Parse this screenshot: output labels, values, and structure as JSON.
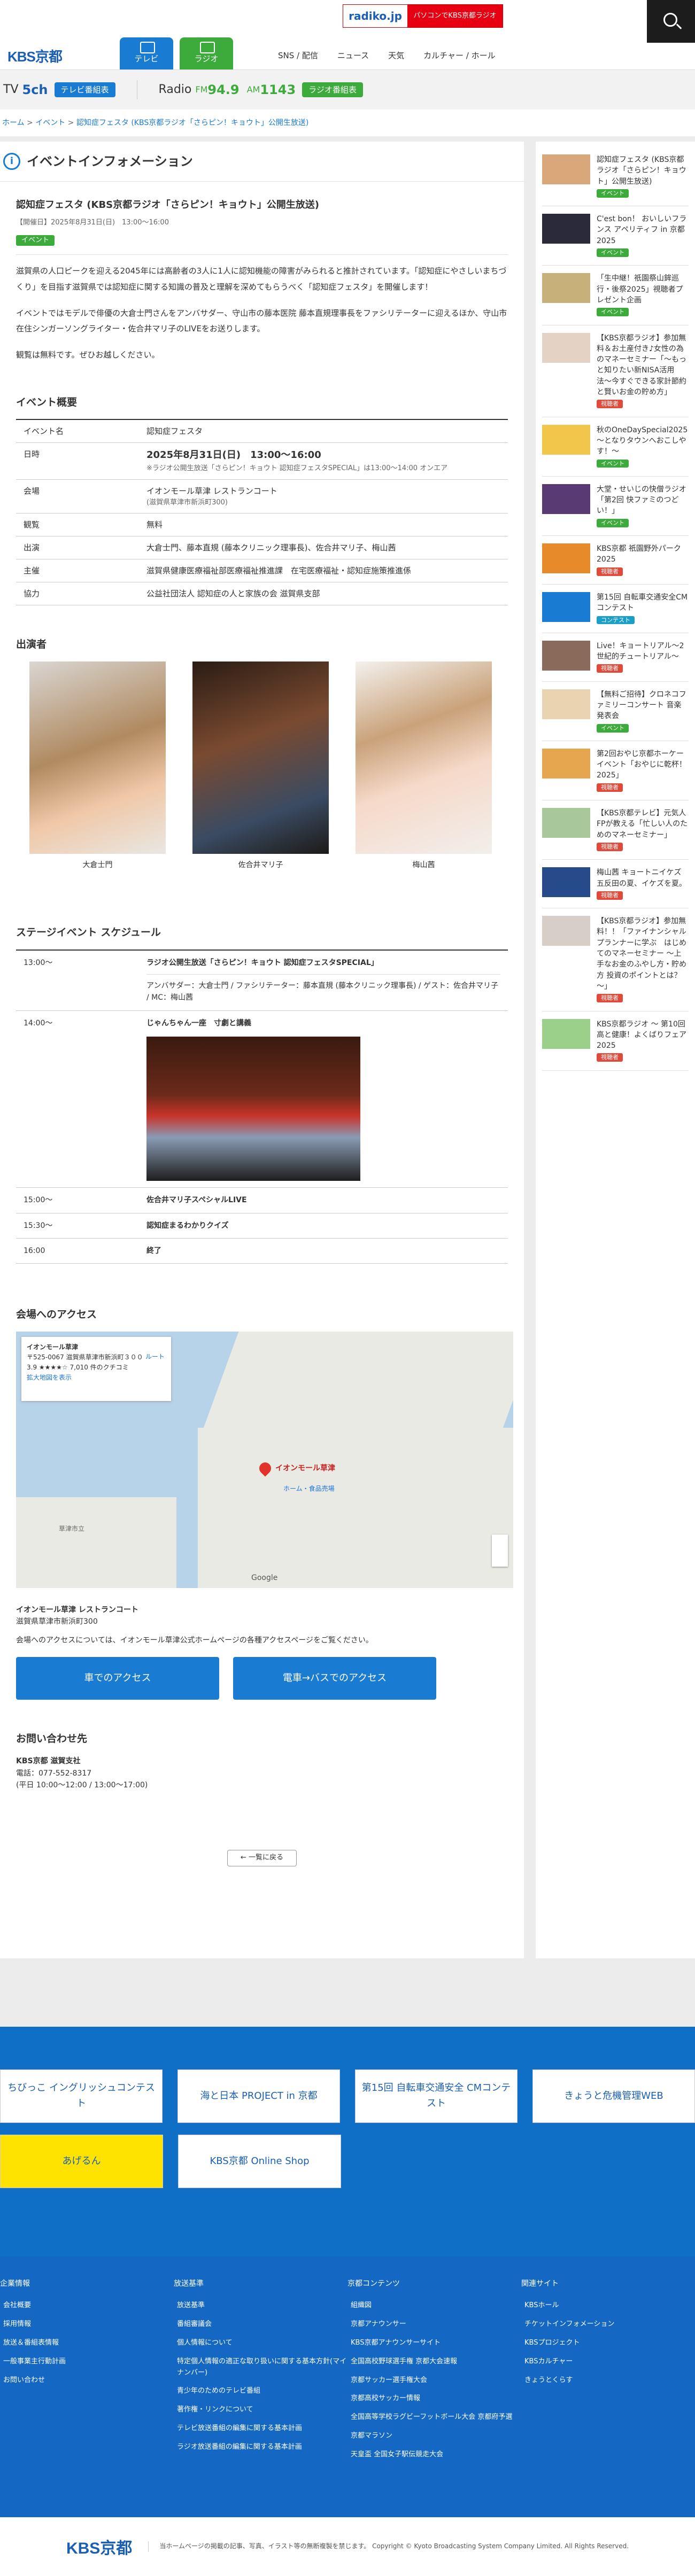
{
  "header": {
    "logo": "KBS京都",
    "tv_tab": "テレビ",
    "radio_tab": "ラジオ",
    "nav": [
      "SNS / 配信",
      "ニュース",
      "天気",
      "カルチャー / ホール"
    ],
    "radiko": {
      "brand": "radiko.jp",
      "text": "パソコンでKBS京都ラジオ"
    }
  },
  "stations": {
    "tv_label": "TV",
    "tv_ch": "5ch",
    "tv_pill": "テレビ番組表",
    "radio_label": "Radio",
    "fm_label": "FM",
    "fm_freq": "94.9",
    "am_label": "AM",
    "am_freq": "1143",
    "radio_pill": "ラジオ番組表"
  },
  "breadcrumb": {
    "home": "ホーム",
    "sep": " > ",
    "events": "イベント",
    "current": "認知症フェスタ (KBS京都ラジオ「さらピン！キョウト」公開生放送)"
  },
  "page_heading": "イベントインフォメーション",
  "article": {
    "title": "認知症フェスタ (KBS京都ラジオ「さらピン！キョウト」公開生放送)",
    "date": "【開催日】2025年8月31日(日)　13:00～16:00",
    "tag": "イベント",
    "paragraphs": [
      "滋賀県の人口ピークを迎える2045年には高齢者の3人に1人に認知機能の障害がみられると推計されています。「認知症にやさしいまちづくり」を目指す滋賀県では認知症に関する知識の普及と理解を深めてもらうべく「認知症フェスタ」を開催します！",
      "イベントではモデルで俳優の大倉士門さんをアンバサダー、守山市の藤本医院 藤本直規理事長をファシリテーターに迎えるほか、守山市在住シンガーソングライター・佐合井マリ子のLIVEをお送りします。",
      "観覧は無料です。ぜひお越しください。"
    ]
  },
  "overview": {
    "heading": "イベント概要",
    "rows": [
      {
        "k": "イベント名",
        "v": "認知症フェスタ",
        "v2": ""
      },
      {
        "k": "日時",
        "v": "2025年8月31日(日)　13:00～16:00",
        "v2": "※ラジオ公開生放送「さらピン！キョウト 認知症フェスタSPECIAL」は13:00～14:00 オンエア"
      },
      {
        "k": "会場",
        "v": "イオンモール草津 レストランコート",
        "v2": "(滋賀県草津市新浜町300)"
      },
      {
        "k": "観覧",
        "v": "無料",
        "v2": ""
      },
      {
        "k": "出演",
        "v": "大倉士門、藤本直規 (藤本クリニック理事長)、佐合井マリ子、梅山茜",
        "v2": ""
      },
      {
        "k": "主催",
        "v": "滋賀県健康医療福祉部医療福祉推進課　在宅医療福祉・認知症施策推進係",
        "v2": ""
      },
      {
        "k": "協力",
        "v": "公益社団法人 認知症の人と家族の会 滋賀県支部",
        "v2": ""
      }
    ]
  },
  "cast": {
    "heading": "出演者",
    "names": [
      "大倉士門",
      "佐合井マリ子",
      "梅山茜"
    ]
  },
  "schedule": {
    "heading": "ステージイベント スケジュール",
    "rows": [
      {
        "t": "13:00～",
        "title": "ラジオ公開生放送「さらピン！キョウト 認知症フェスタSPECIAL」",
        "sub": "アンバサダー：大倉士門 / ファシリテーター：藤本直規 (藤本クリニック理事長) / ゲスト：佐合井マリ子 / MC：梅山茜"
      },
      {
        "t": "14:00～",
        "title": "じゃんちゃん一座　寸劇と講義",
        "sub": ""
      },
      {
        "t": "15:00～",
        "title": "佐合井マリ子スペシャルLIVE",
        "sub": ""
      },
      {
        "t": "15:30～",
        "title": "認知症まるわかりクイズ",
        "sub": ""
      },
      {
        "t": "16:00",
        "title": "終了",
        "sub": ""
      }
    ]
  },
  "access": {
    "heading": "会場へのアクセス",
    "map_card": {
      "name": "イオンモール草津",
      "addr": "〒525-0067 滋賀県草津市新浜町３００",
      "rating": "3.9 ★★★★☆ 7,010 件のクチコミ",
      "link": "拡大地図を表示",
      "route": "ルート"
    },
    "map_labels": [
      "イオンモール草津",
      "ホーム・食品売場",
      "草津市立",
      "Google"
    ],
    "venue": "イオンモール草津 レストランコート",
    "addr": "滋賀県草津市新浜町300",
    "note": "会場へのアクセスについては、イオンモール草津公式ホームページの各種アクセスページをご覧ください。",
    "btn_car": "車でのアクセス",
    "btn_train": "電車→バスでのアクセス"
  },
  "contact": {
    "heading": "お問い合わせ先",
    "org": "KBS京都 滋賀支社",
    "tel": "電話：077-552-8317",
    "hours": "(平日 10:00～12:00 / 13:00～17:00)"
  },
  "back": "一覧に戻る",
  "sidebar": [
    {
      "title": "認知症フェスタ (KBS京都ラジオ「さらピン！キョウト」公開生放送)",
      "tag": "イベント",
      "color": "#3cab3b"
    },
    {
      "title": "C'est bon！ おいしいフランス アペリティフ in 京都2025",
      "tag": "イベント",
      "color": "#3cab3b"
    },
    {
      "title": "「生中継！祇園祭山鉾巡行・後祭2025」視聴者プレゼント企画",
      "tag": "イベント",
      "color": "#3cab3b"
    },
    {
      "title": "【KBS京都ラジオ】参加無料＆お土産付き♪女性の為のマネーセミナー「〜もっと知りたい新NISA活用法〜今すぐできる家計節約と賢いお金の貯め方」",
      "tag": "視聴者",
      "color": "#e04a3a"
    },
    {
      "title": "秋のOneDaySpecial2025 ～となりタウンへおこしやす！～",
      "tag": "イベント",
      "color": "#3cab3b"
    },
    {
      "title": "大堂・せいじの快僧ラジオ「第2回 快ファミのつどい！」",
      "tag": "イベント",
      "color": "#3cab3b"
    },
    {
      "title": "KBS京都 祇園野外パーク2025",
      "tag": "視聴者",
      "color": "#e04a3a"
    },
    {
      "title": "第15回 自転車交通安全CMコンテスト",
      "tag": "コンテスト",
      "color": "#1aa0c8"
    },
    {
      "title": "Live！キョートリアル～2世紀的チュートリアル～",
      "tag": "視聴者",
      "color": "#e04a3a"
    },
    {
      "title": "【無料ご招待】クロネコファミリーコンサート 音楽発表会",
      "tag": "イベント",
      "color": "#3cab3b"
    },
    {
      "title": "第2回おやじ京都ホーケーイベント「おやじに乾杯！2025」",
      "tag": "視聴者",
      "color": "#e04a3a"
    },
    {
      "title": "【KBS京都テレビ】元気人FPが教える「忙しい人のためのマネーセミナー」",
      "tag": "視聴者",
      "color": "#e04a3a"
    },
    {
      "title": "梅山茜 キョートニイケズ　五反田の夏、イケズを夏。",
      "tag": "視聴者",
      "color": "#e04a3a"
    },
    {
      "title": "【KBS京都ラジオ】参加無料！！「ファイナンシャルプランナーに学ぶ　はじめてのマネーセミナー ～上手なお金のふやし方・貯め方 投資のポイントとは？～」",
      "tag": "視聴者",
      "color": "#e04a3a"
    },
    {
      "title": "KBS京都ラジオ 〜 第10回 高と健康！よくばりフェア2025",
      "tag": "視聴者",
      "color": "#e04a3a"
    }
  ],
  "banners": [
    "ちびっこ イングリッシュコンテスト",
    "海と日本 PROJECT in 京都",
    "第15回 自転車交通安全 CMコンテスト",
    "きょうと危機管理WEB",
    "あげるん",
    "KBS京都 Online Shop"
  ],
  "footer": {
    "cols": [
      {
        "h": "企業情報",
        "items": [
          "会社概要",
          "採用情報",
          "放送＆番組表情報",
          "一般事業主行動計画",
          "お問い合わせ"
        ]
      },
      {
        "h": "放送基準",
        "items": [
          "放送基準",
          "番組審議会",
          "個人情報について",
          "特定個人情報の適正な取り扱いに関する基本方針(マイナンバー)",
          "青少年のためのテレビ番組",
          "著作権・リンクについて",
          "テレビ放送番組の編集に関する基本計画",
          "ラジオ放送番組の編集に関する基本計画"
        ]
      },
      {
        "h": "京都コンテンツ",
        "items": [
          "組織図",
          "京都アナウンサー",
          "KBS京都アナウンサーサイト",
          "全国高校野球選手権 京都大会速報",
          "京都サッカー選手権大会",
          "京都高校サッカー情報",
          "全国高等学校ラグビーフットボール大会 京都府予選",
          "京都マラソン",
          "天皇盃 全国女子駅伝競走大会"
        ]
      },
      {
        "h": "関連サイト",
        "items": [
          "KBSホール",
          "チケットインフォメーション",
          "KBSプロジェクト",
          "KBSカルチャー",
          "きょうとくらす"
        ]
      }
    ],
    "logo": "KBS京都",
    "copyright": "当ホームページの掲載の記事、写真、イラスト等の無断複製を禁じます。 Copyright © Kyoto Broadcasting System Company Limited. All Rights Reserved."
  }
}
